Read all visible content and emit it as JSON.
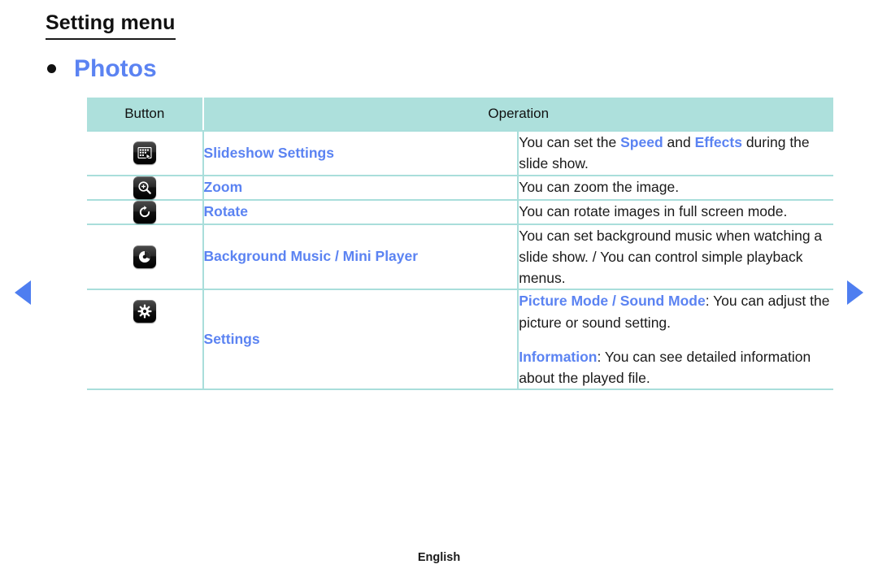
{
  "page": {
    "title": "Setting menu",
    "section_bullet_title": "Photos",
    "footer_language": "English"
  },
  "nav": {
    "prev_label": "",
    "next_label": ""
  },
  "table": {
    "headers": {
      "button": "Button",
      "operation": "Operation"
    },
    "rows": [
      {
        "icon": "slideshow-settings-icon",
        "label": "Slideshow Settings",
        "operation_plain": "You can set the Speed and Effects during the slide show.",
        "operation_parts": [
          {
            "text": "You can set the ",
            "highlight": false
          },
          {
            "text": "Speed",
            "highlight": true
          },
          {
            "text": " and ",
            "highlight": false
          },
          {
            "text": "Effects",
            "highlight": true
          },
          {
            "text": " during the slide show.",
            "highlight": false
          }
        ]
      },
      {
        "icon": "zoom-icon",
        "label": "Zoom",
        "operation_plain": "You can zoom the image.",
        "operation_parts": [
          {
            "text": "You can zoom the image.",
            "highlight": false
          }
        ]
      },
      {
        "icon": "rotate-icon",
        "label": "Rotate",
        "operation_plain": "You can rotate images in full screen mode.",
        "operation_parts": [
          {
            "text": "You can rotate images in full screen mode.",
            "highlight": false
          }
        ]
      },
      {
        "icon": "background-music-icon",
        "label": "Background Music / Mini Player",
        "operation_plain": "You can set background music when watching a slide show. / You can control simple playback menus.",
        "operation_parts": [
          {
            "text": "You can set background music when watching a slide show. / You can control simple playback menus.",
            "highlight": false
          }
        ]
      },
      {
        "icon": "settings-gear-icon",
        "label": "Settings",
        "operation_plain": "Picture Mode / Sound Mode: You can adjust the picture or sound setting. Information: You can see detailed information about the played file.",
        "operation_paragraphs": [
          [
            {
              "text": "Picture Mode / Sound Mode",
              "highlight": true
            },
            {
              "text": ": You can adjust the picture or sound setting.",
              "highlight": false
            }
          ],
          [
            {
              "text": "Information",
              "highlight": true
            },
            {
              "text": ": You can see detailed information about the played file.",
              "highlight": false
            }
          ]
        ]
      }
    ]
  },
  "colors": {
    "accent_blue": "#5b83f2",
    "header_teal": "#ade0dc",
    "border_teal": "#a9dedb",
    "arrow_blue": "#4e7ef0",
    "text_black": "#1a1a1a"
  }
}
